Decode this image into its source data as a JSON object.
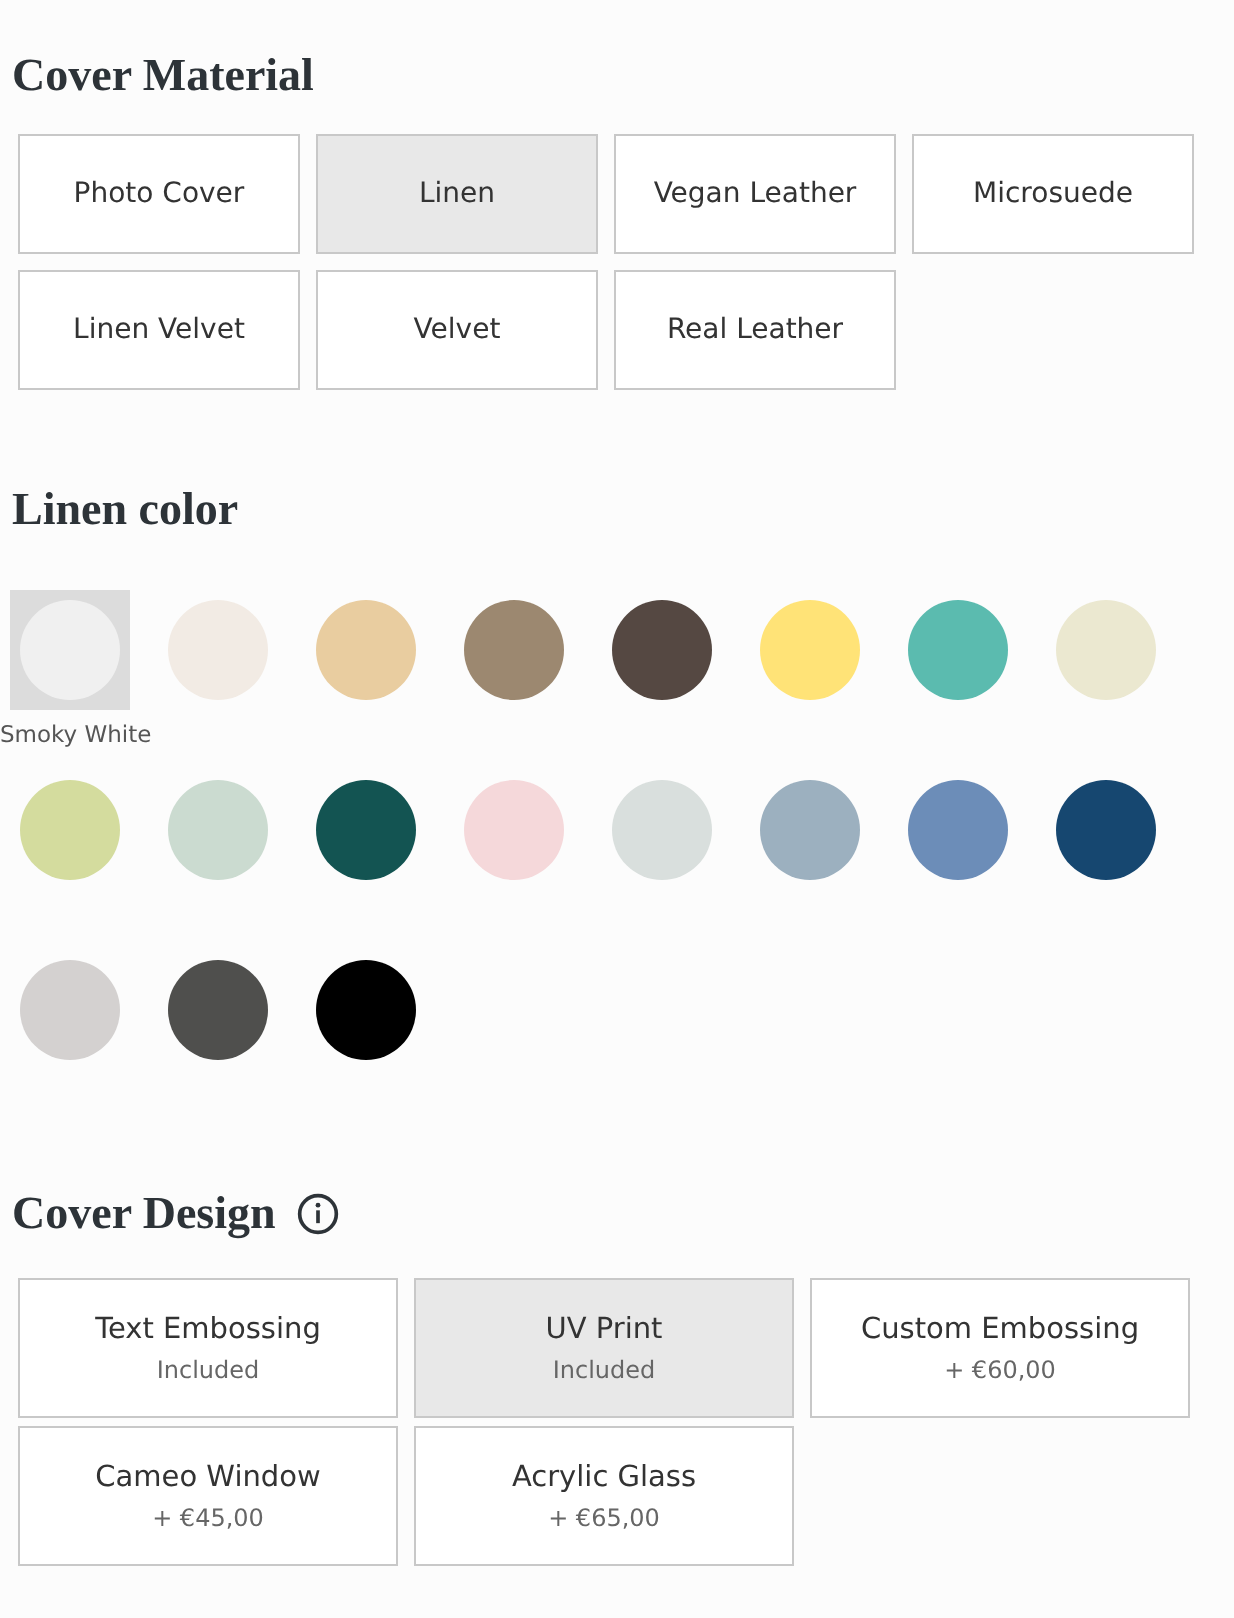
{
  "cover_material": {
    "title": "Cover Material",
    "options": [
      {
        "label": "Photo Cover",
        "selected": false
      },
      {
        "label": "Linen",
        "selected": true
      },
      {
        "label": "Vegan Leather",
        "selected": false
      },
      {
        "label": "Microsuede",
        "selected": false
      },
      {
        "label": "Linen Velvet",
        "selected": false
      },
      {
        "label": "Velvet",
        "selected": false
      },
      {
        "label": "Real Leather",
        "selected": false
      }
    ]
  },
  "linen_color": {
    "title": "Linen color",
    "swatches": [
      {
        "color": "#f0f0f0",
        "selected": true,
        "label": "Smoky White"
      },
      {
        "color": "#f2ebe4",
        "selected": false
      },
      {
        "color": "#e9cda0",
        "selected": false
      },
      {
        "color": "#9c8870",
        "selected": false
      },
      {
        "color": "#554842",
        "selected": false
      },
      {
        "color": "#ffe377",
        "selected": false
      },
      {
        "color": "#5bbbaf",
        "selected": false
      },
      {
        "color": "#ebe8d0",
        "selected": false
      },
      {
        "color": "#d4dc9e",
        "selected": false
      },
      {
        "color": "#cbdbd0",
        "selected": false
      },
      {
        "color": "#135452",
        "selected": false
      },
      {
        "color": "#f5d8da",
        "selected": false
      },
      {
        "color": "#d9dfdd",
        "selected": false
      },
      {
        "color": "#9cb0bf",
        "selected": false
      },
      {
        "color": "#6c8db8",
        "selected": false
      },
      {
        "color": "#164770",
        "selected": false
      },
      {
        "color": "#d4d1d0",
        "selected": false
      },
      {
        "color": "#4f4f4d",
        "selected": false
      },
      {
        "color": "#000000",
        "selected": false
      }
    ]
  },
  "cover_design": {
    "title": "Cover Design",
    "options": [
      {
        "label": "Text Embossing",
        "price": "Included",
        "selected": false
      },
      {
        "label": "UV Print",
        "price": "Included",
        "selected": true
      },
      {
        "label": "Custom Embossing",
        "price": "+ €60,00",
        "selected": false
      },
      {
        "label": "Cameo Window",
        "price": "+ €45,00",
        "selected": false
      },
      {
        "label": "Acrylic Glass",
        "price": "+ €65,00",
        "selected": false
      }
    ]
  }
}
